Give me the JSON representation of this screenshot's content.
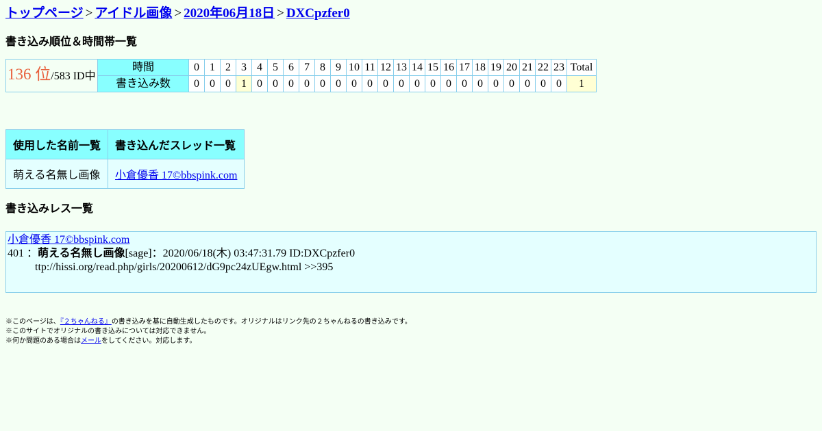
{
  "breadcrumb": {
    "top": "トップページ",
    "board": "アイドル画像",
    "date": "2020年06月18日",
    "id": "DXCpzfer0",
    "separator": ">"
  },
  "rank_heading": "書き込み順位＆時間帯一覧",
  "stats": {
    "rank": "136 位",
    "rank_total": "/583 ID中",
    "hour_label": "時間",
    "count_label": "書き込み数",
    "hours": [
      "0",
      "1",
      "2",
      "3",
      "4",
      "5",
      "6",
      "7",
      "8",
      "9",
      "10",
      "11",
      "12",
      "13",
      "14",
      "15",
      "16",
      "17",
      "18",
      "19",
      "20",
      "21",
      "22",
      "23",
      "Total"
    ],
    "counts": [
      "0",
      "0",
      "0",
      "1",
      "0",
      "0",
      "0",
      "0",
      "0",
      "0",
      "0",
      "0",
      "0",
      "0",
      "0",
      "0",
      "0",
      "0",
      "0",
      "0",
      "0",
      "0",
      "0",
      "0",
      "1"
    ]
  },
  "names_table": {
    "col_names": "使用した名前一覧",
    "col_threads": "書き込んだスレッド一覧",
    "name": "萌える名無し画像",
    "thread": "小倉優香 17©bbspink.com"
  },
  "res_heading": "書き込みレス一覧",
  "res": {
    "thread_title": "小倉優香 17©bbspink.com",
    "number": "401",
    "colon": "：",
    "name": "萌える名無し画像",
    "mail": "[sage]",
    "datetime": "2020/06/18(木) 03:47:31.79 ID:DXCpzfer0",
    "body": "ttp://hissi.org/read.php/girls/20200612/dG9pc24zUEgw.html >>395"
  },
  "footer": {
    "line1_pre": "※このページは、",
    "line1_link": "『２ちゃんねる』",
    "line1_post": "の書き込みを基に自動生成したものです。オリジナルはリンク先の２ちゃんねるの書き込みです。",
    "line2": "※このサイトでオリジナルの書き込みについては対応できません。",
    "line3_pre": "※何か問題のある場合は",
    "line3_link": "メール",
    "line3_post": "をしてください。対応します。"
  }
}
